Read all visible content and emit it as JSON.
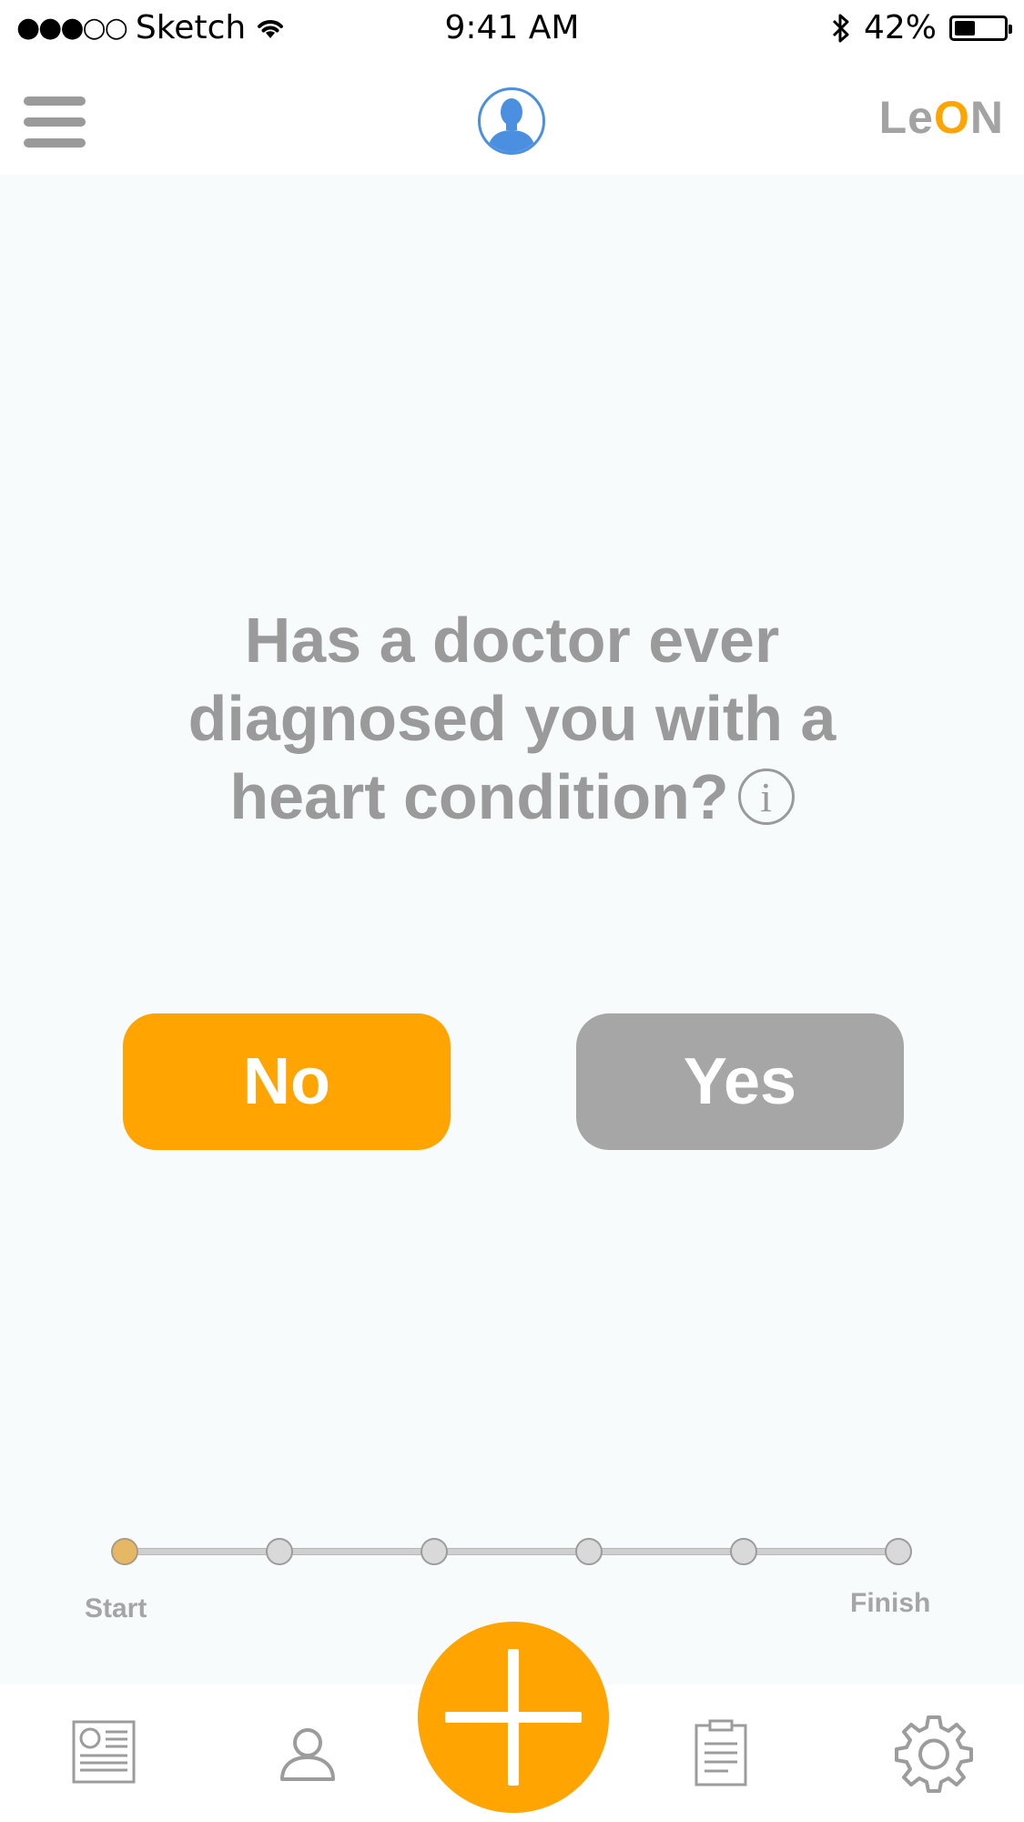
{
  "status_bar": {
    "signal": "●●●○○",
    "carrier": "Sketch",
    "time": "9:41 AM",
    "battery_percent": "42%",
    "battery_level": 0.42
  },
  "header": {
    "menu_icon": "hamburger-menu-icon",
    "avatar_icon": "user-silhouette-icon",
    "logo_prefix": "Le",
    "logo_accent": "O",
    "logo_suffix": "N"
  },
  "question": {
    "text": "Has a doctor ever diagnosed you with a heart condition?",
    "info_glyph": "i"
  },
  "answers": {
    "no_label": "No",
    "yes_label": "Yes"
  },
  "progress": {
    "start_label": "Start",
    "finish_label": "Finish",
    "steps_total": 6,
    "current_step": 1
  },
  "tab_bar": {
    "items": [
      {
        "icon": "newspaper-icon"
      },
      {
        "icon": "profile-icon"
      },
      {
        "icon": "add-icon"
      },
      {
        "icon": "clipboard-icon"
      },
      {
        "icon": "gear-icon"
      }
    ]
  },
  "colors": {
    "accent": "#ffa400",
    "neutral_button": "#a6a6a6",
    "text_gray": "#9a9a9a",
    "avatar_blue": "#4a8fe0",
    "background": "#f8fbfc"
  }
}
